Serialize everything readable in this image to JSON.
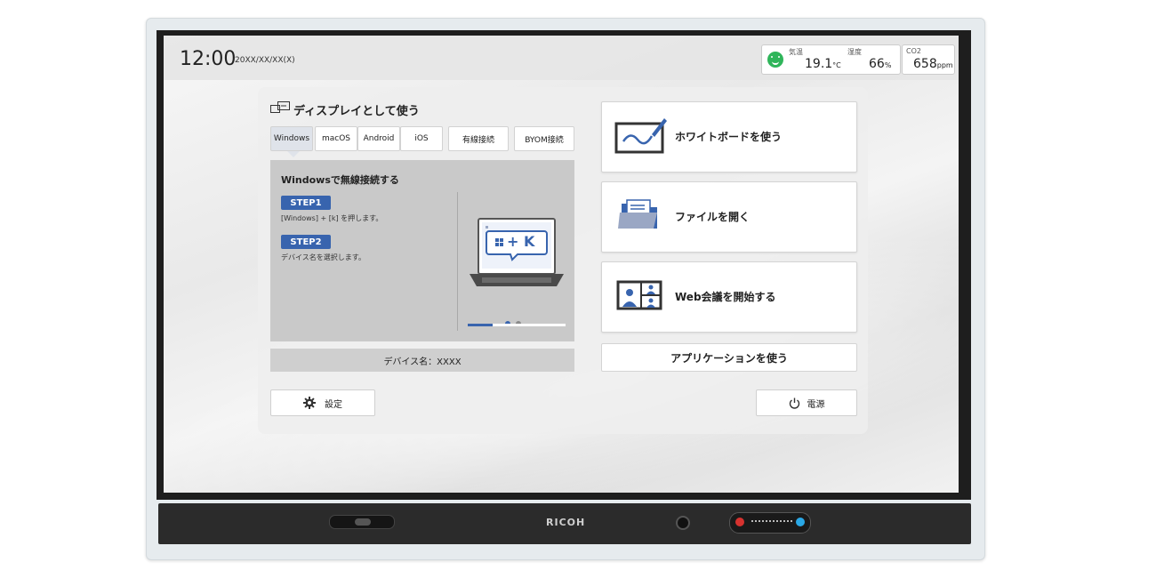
{
  "status_bar": {
    "time": "12:00",
    "date": "20XX/XX/XX(X)",
    "environment": {
      "temperature": {
        "label": "気温",
        "value": "19.1",
        "unit": "°C"
      },
      "humidity": {
        "label": "湿度",
        "value": "66",
        "unit": "%"
      },
      "co2": {
        "label": "CO2",
        "value": "658",
        "unit": "ppm"
      },
      "status_color": "#2fb55a"
    }
  },
  "display_section": {
    "title": "ディスプレイとして使う",
    "tabs": [
      {
        "label": "Windows",
        "active": true
      },
      {
        "label": "macOS"
      },
      {
        "label": "Android"
      },
      {
        "label": "iOS"
      },
      {
        "label": "有線接続"
      },
      {
        "label": "BYOM接続"
      }
    ],
    "guide": {
      "heading": "Windowsで無線接続する",
      "steps": [
        {
          "label": "STEP1",
          "text": "[Windows] + [k] を押します。"
        },
        {
          "label": "STEP2",
          "text": "デバイス名を選択します。"
        }
      ],
      "illustration_keys": "+ K",
      "page_count": 2,
      "current_page": 1
    },
    "device_name": "デバイス名：XXXX"
  },
  "actions": {
    "whiteboard": "ホワイトボードを使う",
    "open_file": "ファイルを開く",
    "web_meeting": "Web会議を開始する",
    "applications": "アプリケーションを使う"
  },
  "footer": {
    "settings": "設定",
    "power": "電源"
  },
  "device": {
    "brand": "RICOH"
  },
  "colors": {
    "accent": "#3864ae",
    "status_ok": "#2fb55a"
  }
}
